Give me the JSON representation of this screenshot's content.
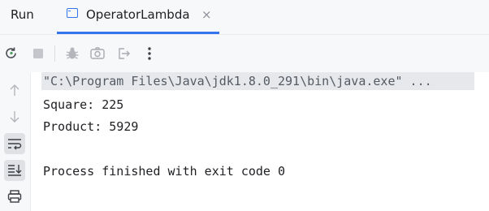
{
  "panel": {
    "title": "Run"
  },
  "tab": {
    "title": "OperatorLambda",
    "close": "×",
    "icon": "console-window-icon",
    "accent": "#3574f0"
  },
  "toolbar": {
    "buttons": [
      {
        "name": "rerun-icon"
      },
      {
        "name": "stop-icon"
      },
      {
        "name": "debug-icon"
      },
      {
        "name": "camera-icon"
      },
      {
        "name": "exit-icon"
      },
      {
        "name": "more-icon"
      }
    ]
  },
  "gutter": {
    "buttons": [
      {
        "name": "scroll-up-icon"
      },
      {
        "name": "scroll-down-icon"
      },
      {
        "name": "soft-wrap-icon"
      },
      {
        "name": "scroll-to-end-icon"
      },
      {
        "name": "print-icon"
      }
    ]
  },
  "console": {
    "command": "\"C:\\Program Files\\Java\\jdk1.8.0_291\\bin\\java.exe\" ...",
    "lines": [
      "Square: 225",
      "Product: 5929",
      "",
      "Process finished with exit code 0"
    ]
  }
}
